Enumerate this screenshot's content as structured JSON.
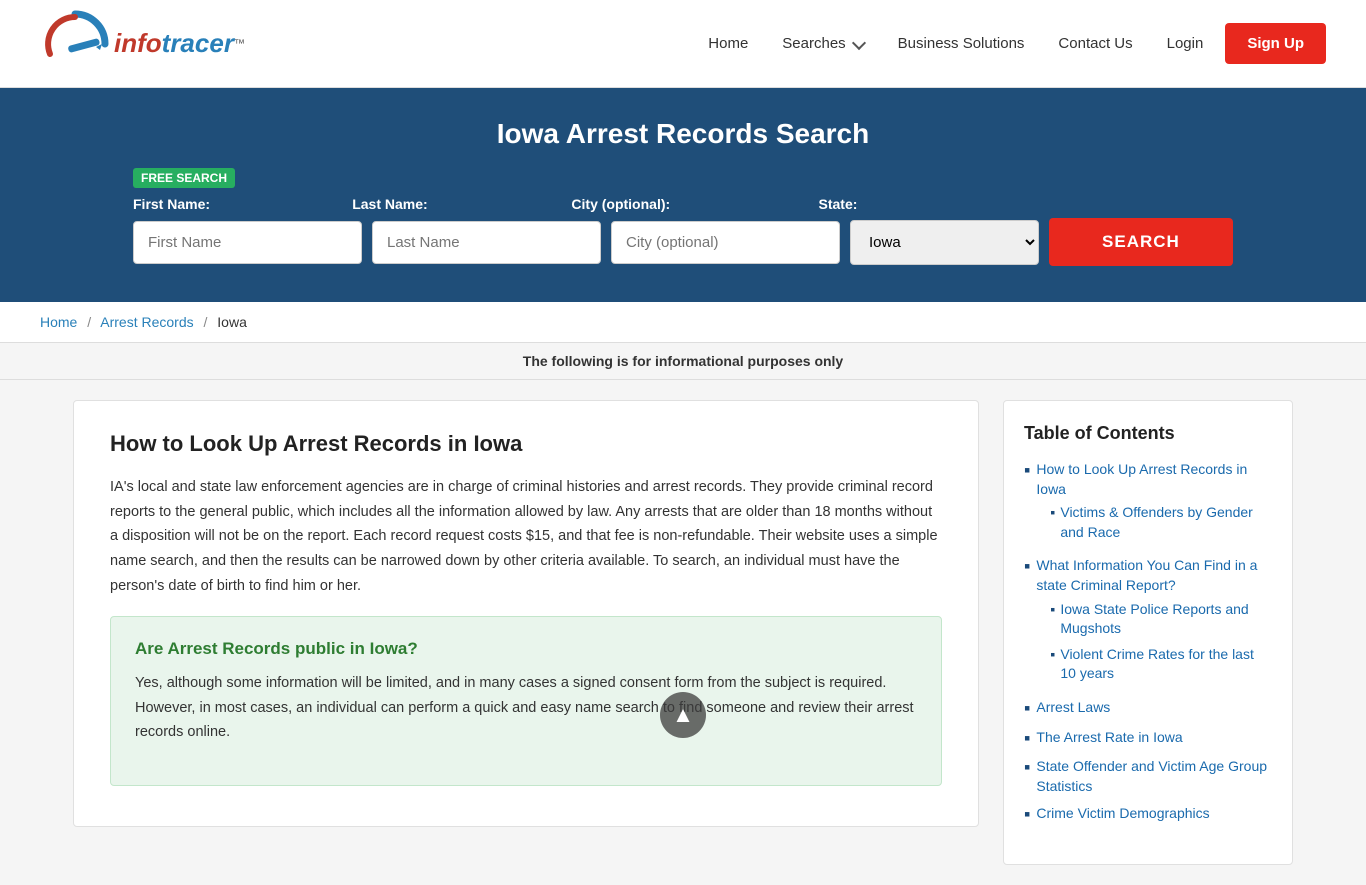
{
  "header": {
    "logo_info": "info",
    "logo_tracer": "tracer",
    "logo_tm": "™",
    "nav": {
      "home": "Home",
      "searches": "Searches",
      "business": "Business Solutions",
      "contact": "Contact Us",
      "login": "Login",
      "signup": "Sign Up"
    }
  },
  "hero": {
    "title": "Iowa Arrest Records Search",
    "badge": "FREE SEARCH",
    "form": {
      "first_name_label": "First Name:",
      "last_name_label": "Last Name:",
      "city_label": "City (optional):",
      "state_label": "State:",
      "first_name_placeholder": "First Name",
      "last_name_placeholder": "Last Name",
      "city_placeholder": "City (optional)",
      "state_default": "Iowa",
      "search_btn": "SEARCH"
    }
  },
  "breadcrumb": {
    "home": "Home",
    "arrest": "Arrest Records",
    "current": "Iowa"
  },
  "info_bar": "The following is for informational purposes only",
  "article": {
    "heading": "How to Look Up Arrest Records in Iowa",
    "paragraph1": "IA's local and state law enforcement agencies are in charge of criminal histories and arrest records. They provide criminal record reports to the general public, which includes all the information allowed by law. Any arrests that are older than 18 months without a disposition will not be on the report. Each record request costs $15, and that fee is non-refundable. Their website uses a simple name search, and then the results can be narrowed down by other criteria available. To search, an individual must have the person's date of birth to find him or her.",
    "green_box": {
      "heading": "Are Arrest Records public in Iowa?",
      "paragraph": "Yes, although some information will be limited, and in many cases a signed consent form from the subject is required. However, in most cases, an individual can perform a quick and easy name search to find someone and review their arrest records online."
    }
  },
  "sidebar": {
    "title": "Table of Contents",
    "items": [
      {
        "label": "How to Look Up Arrest Records in Iowa",
        "sub": [
          {
            "label": "Victims & Offenders by Gender and Race"
          }
        ]
      },
      {
        "label": "What Information You Can Find in a state Criminal Report?",
        "sub": [
          {
            "label": "Iowa State Police Reports and Mugshots"
          },
          {
            "label": "Violent Crime Rates for the last 10 years"
          }
        ]
      },
      {
        "label": "Arrest Laws",
        "sub": []
      },
      {
        "label": "The Arrest Rate in Iowa",
        "sub": []
      },
      {
        "label": "State Offender and Victim Age Group Statistics",
        "sub": []
      },
      {
        "label": "Crime Victim Demographics",
        "sub": []
      }
    ]
  },
  "scroll_top_icon": "▲"
}
